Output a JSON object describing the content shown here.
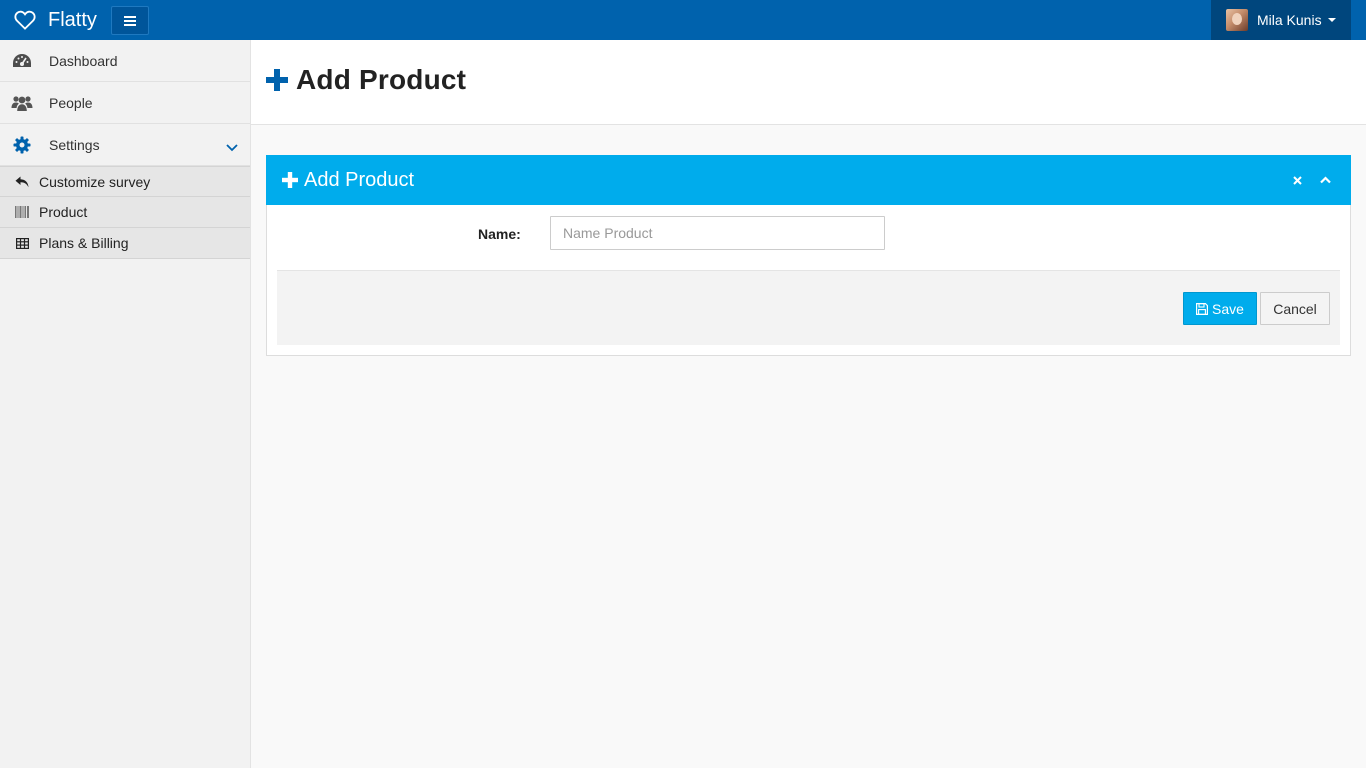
{
  "navbar": {
    "brand": "Flatty",
    "user_name": "Mila Kunis"
  },
  "sidebar": {
    "items": [
      {
        "label": "Dashboard",
        "icon": "dashboard-icon"
      },
      {
        "label": "People",
        "icon": "people-icon"
      },
      {
        "label": "Settings",
        "icon": "gear-icon",
        "expanded": true
      }
    ],
    "submenu": [
      {
        "label": "Customize survey",
        "icon": "reply-icon"
      },
      {
        "label": "Product",
        "icon": "barcode-icon"
      },
      {
        "label": "Plans & Billing",
        "icon": "table-icon"
      }
    ]
  },
  "page": {
    "title": "Add Product"
  },
  "box": {
    "title": "Add Product",
    "form": {
      "name_label": "Name:",
      "name_value": "",
      "name_placeholder": "Name Product"
    },
    "save_label": "Save",
    "cancel_label": "Cancel"
  },
  "colors": {
    "navbar": "#0062ad",
    "user_menu": "#00467d",
    "accent": "#00acec",
    "sidebar_bg": "#f2f2f2"
  }
}
